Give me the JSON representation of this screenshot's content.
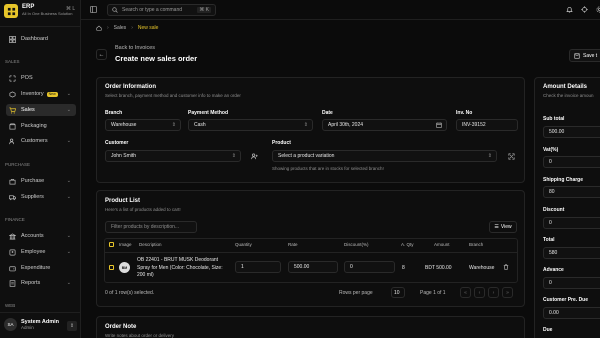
{
  "app": {
    "name": "ERP",
    "tagline": "All In One Business Solution",
    "toggle": "⌘ L"
  },
  "search": {
    "placeholder": "Search or type a command",
    "shortcut": "⌘ K"
  },
  "sidebar": {
    "dashboard": "Dashboard",
    "sections": {
      "sales": "SALES",
      "purchase": "PURCHASE",
      "finance": "FINANCE",
      "web": "WEB"
    },
    "items": {
      "pos": "POS",
      "inventory": "Inventory",
      "inventory_badge": "New",
      "sales": "Sales",
      "packaging": "Packaging",
      "customers": "Customers",
      "purchase": "Purchase",
      "suppliers": "Suppliers",
      "accounts": "Accounts",
      "employee": "Employee",
      "expenditure": "Expenditure",
      "reports": "Reports"
    },
    "user": {
      "initials": "SA",
      "name": "System Admin",
      "role": "Admin"
    }
  },
  "breadcrumb": {
    "sales": "Sales",
    "current": "New sale"
  },
  "header": {
    "back_label": "Back to Invoices",
    "title": "Create new sales order",
    "save_label": "Save t"
  },
  "order_info": {
    "title": "Order Information",
    "description": "Select branch, payment method and customer info to make an order",
    "branch_label": "Branch",
    "branch_value": "Warehouse",
    "payment_label": "Payment Method",
    "payment_value": "Cash",
    "date_label": "Date",
    "date_value": "April 30th, 2024",
    "inv_label": "Inv. No",
    "inv_value": "INV-39152",
    "customer_label": "Customer",
    "customer_value": "John Smith",
    "product_label": "Product",
    "product_placeholder": "Select a product variation",
    "product_hint": "Showing products that are in stocks for selected branch!"
  },
  "product_list": {
    "title": "Product List",
    "description": "Here's a list of products added to cart!",
    "filter_placeholder": "Filter products by description...",
    "view_label": "View",
    "columns": [
      "Image",
      "Description",
      "Quantity",
      "Rate",
      "Discount(%)",
      "A. Qty",
      "Amount",
      "Branch"
    ],
    "row": {
      "image_text": "BM",
      "description": "OB 22401 - BRUT MUSK Deodorant Spray for Men (Color: Chocolate, Size: 200 ml)",
      "quantity": "1",
      "rate": "500.00",
      "discount": "0",
      "a_qty": "8",
      "amount": "BDT 500.00",
      "branch": "Warehouse"
    },
    "selection_text": "0 of 1 row(s) selected.",
    "rows_per_page_label": "Rows per page",
    "rows_per_page_value": "10",
    "page_text": "Page 1 of 1"
  },
  "order_note": {
    "title": "Order Note",
    "description": "Write notes about order or delivery"
  },
  "amount_details": {
    "title": "Amount Details",
    "description": "Check the invoice amoun",
    "sub_total_label": "Sub total",
    "sub_total_value": "500.00",
    "vat_label": "Vat(%)",
    "vat_value": "0",
    "shipping_label": "Shipping Charge",
    "shipping_value": "80",
    "discount_label": "Discount",
    "discount_value": "0",
    "total_label": "Total",
    "total_value": "580",
    "advance_label": "Advance",
    "advance_value": "0",
    "customer_due_label": "Customer Pre. Due",
    "customer_due_value": "0.00",
    "due_label": "Due"
  },
  "colors": {
    "accent": "#e7c52a",
    "background": "#0b0b0b"
  }
}
